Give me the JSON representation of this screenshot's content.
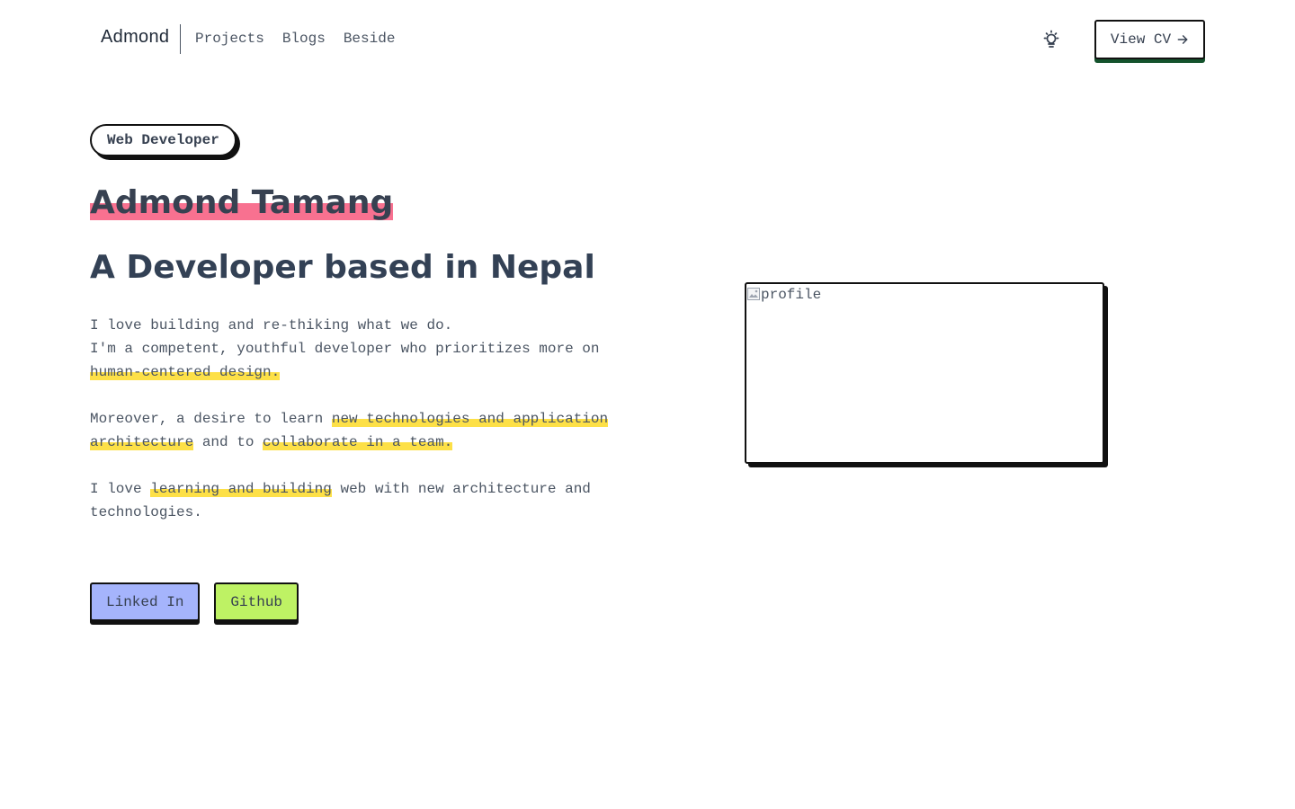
{
  "nav": {
    "brand": "Admond",
    "links": [
      "Projects",
      "Blogs",
      "Beside"
    ],
    "theme_icon": "lightbulb-icon",
    "cv_label": "View CV",
    "cv_icon": "arrow-right-icon"
  },
  "hero": {
    "role": "Web Developer",
    "name": "Admond Tamang",
    "headline": "A Developer based in Nepal",
    "bio": {
      "p1_line1": "I love building and re-thiking what we do.",
      "p1_line2": "I'm a competent, youthful developer who prioritizes more on ",
      "p1_hl": "human-centered design.",
      "p2_text1": "Moreover, a desire to learn ",
      "p2_hl1": "new technologies and application architecture",
      "p2_text2": " and to ",
      "p2_hl2": "collaborate in a team.",
      "p3_text1": "I love ",
      "p3_hl": "learning and building",
      "p3_text2": " web with new architecture and technologies."
    },
    "social": {
      "linkedin": "Linked In",
      "github": "Github"
    }
  },
  "profile": {
    "alt": "profile"
  },
  "colors": {
    "name_highlight": "#f87190",
    "text_highlight": "#fde047",
    "linkedin_bg": "#a5b4fc",
    "github_bg": "#bef264",
    "cv_shadow": "#14532d"
  }
}
